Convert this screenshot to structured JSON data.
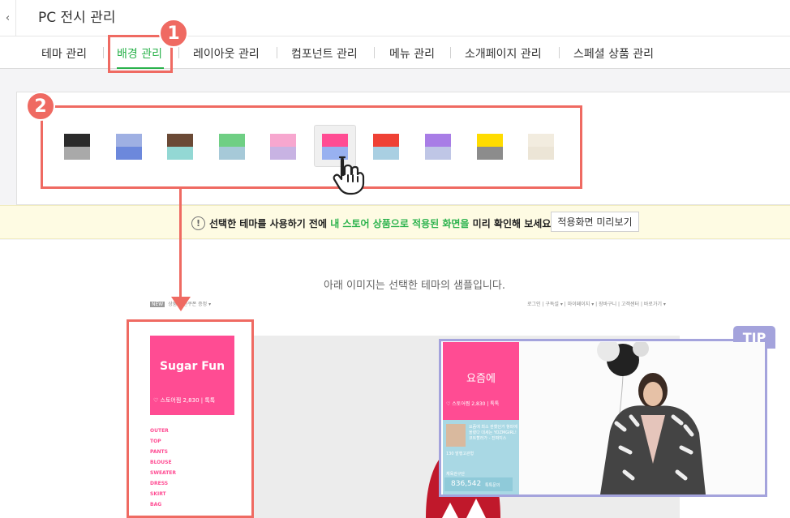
{
  "header": {
    "back_icon": "chevron-left-icon",
    "title": "PC 전시 관리"
  },
  "tabs": [
    {
      "label": "테마 관리",
      "active": false
    },
    {
      "label": "배경 관리",
      "active": true
    },
    {
      "label": "레이아웃 관리",
      "active": false
    },
    {
      "label": "컴포넌트 관리",
      "active": false
    },
    {
      "label": "메뉴 관리",
      "active": false
    },
    {
      "label": "소개페이지 관리",
      "active": false
    },
    {
      "label": "스페셜 상품 관리",
      "active": false
    }
  ],
  "badges": {
    "step1": "1",
    "step2": "2"
  },
  "swatches": [
    {
      "top": "#2b2b2b",
      "bottom": "#a9a9a9"
    },
    {
      "top": "#9fb0e3",
      "bottom": "#6c88dc"
    },
    {
      "top": "#6b4a36",
      "bottom": "#93d8d4"
    },
    {
      "top": "#6fcf84",
      "bottom": "#a6c9d8"
    },
    {
      "top": "#f7a7cf",
      "bottom": "#c8b3e3"
    },
    {
      "top": "#ff4c93",
      "bottom": "#98b1f0"
    },
    {
      "top": "#ef4135",
      "bottom": "#a9cfe2"
    },
    {
      "top": "#a87de6",
      "bottom": "#bfc6e6"
    },
    {
      "top": "#ffdc00",
      "bottom": "#8c8c8c"
    },
    {
      "top": "#f2ecdf",
      "bottom": "#ece5d6"
    }
  ],
  "selected_swatch": 5,
  "notice": {
    "icon": "exclamation-circle-icon",
    "text_before": "선택한 테마를 사용하기 전에 ",
    "text_highlight": "내 스토어 상품으로 적용된 화면을",
    "text_after": " 미리 확인해 보세요.",
    "button_label": "적용화면 미리보기"
  },
  "sample": {
    "caption": "아래 이미지는 선택한 테마의 샘플입니다.",
    "topbar_tag": "NEW",
    "topbar_left": "상품 할인쿠폰 증정 ▾",
    "topbar_right": "로그인 | 구독설 ▾ | 마이페이지 ▾ | 장바구니 | 고객센터 | 바로가기 ▾",
    "logo": "Sugar Fun",
    "logo_meta": "♡ 스토어찜 2,830  |  톡톡",
    "categories": [
      "OUTER",
      "TOP",
      "PANTS",
      "BLOUSE",
      "SWEATER",
      "DRESS",
      "SKIRT",
      "BAG"
    ]
  },
  "tip": {
    "label": "TIP",
    "store_name": "요즘에",
    "store_meta": "♡ 스토어찜 2,830  |  톡톡",
    "desc": "요즘에 최소 판했던거 항파에 올렸다 대세는 YOZMGIRL! 코트할러가 - 진짜지스",
    "small_label": "130 발행고관형",
    "stat_label": "체육관구단",
    "stat_value": "836,542",
    "stat_button": "톡톡문의"
  },
  "colors": {
    "accent_green": "#2bb24c",
    "highlight_red": "#ef6a62",
    "tip_purple": "#a4a3dc",
    "brand_pink": "#ff4c93"
  }
}
